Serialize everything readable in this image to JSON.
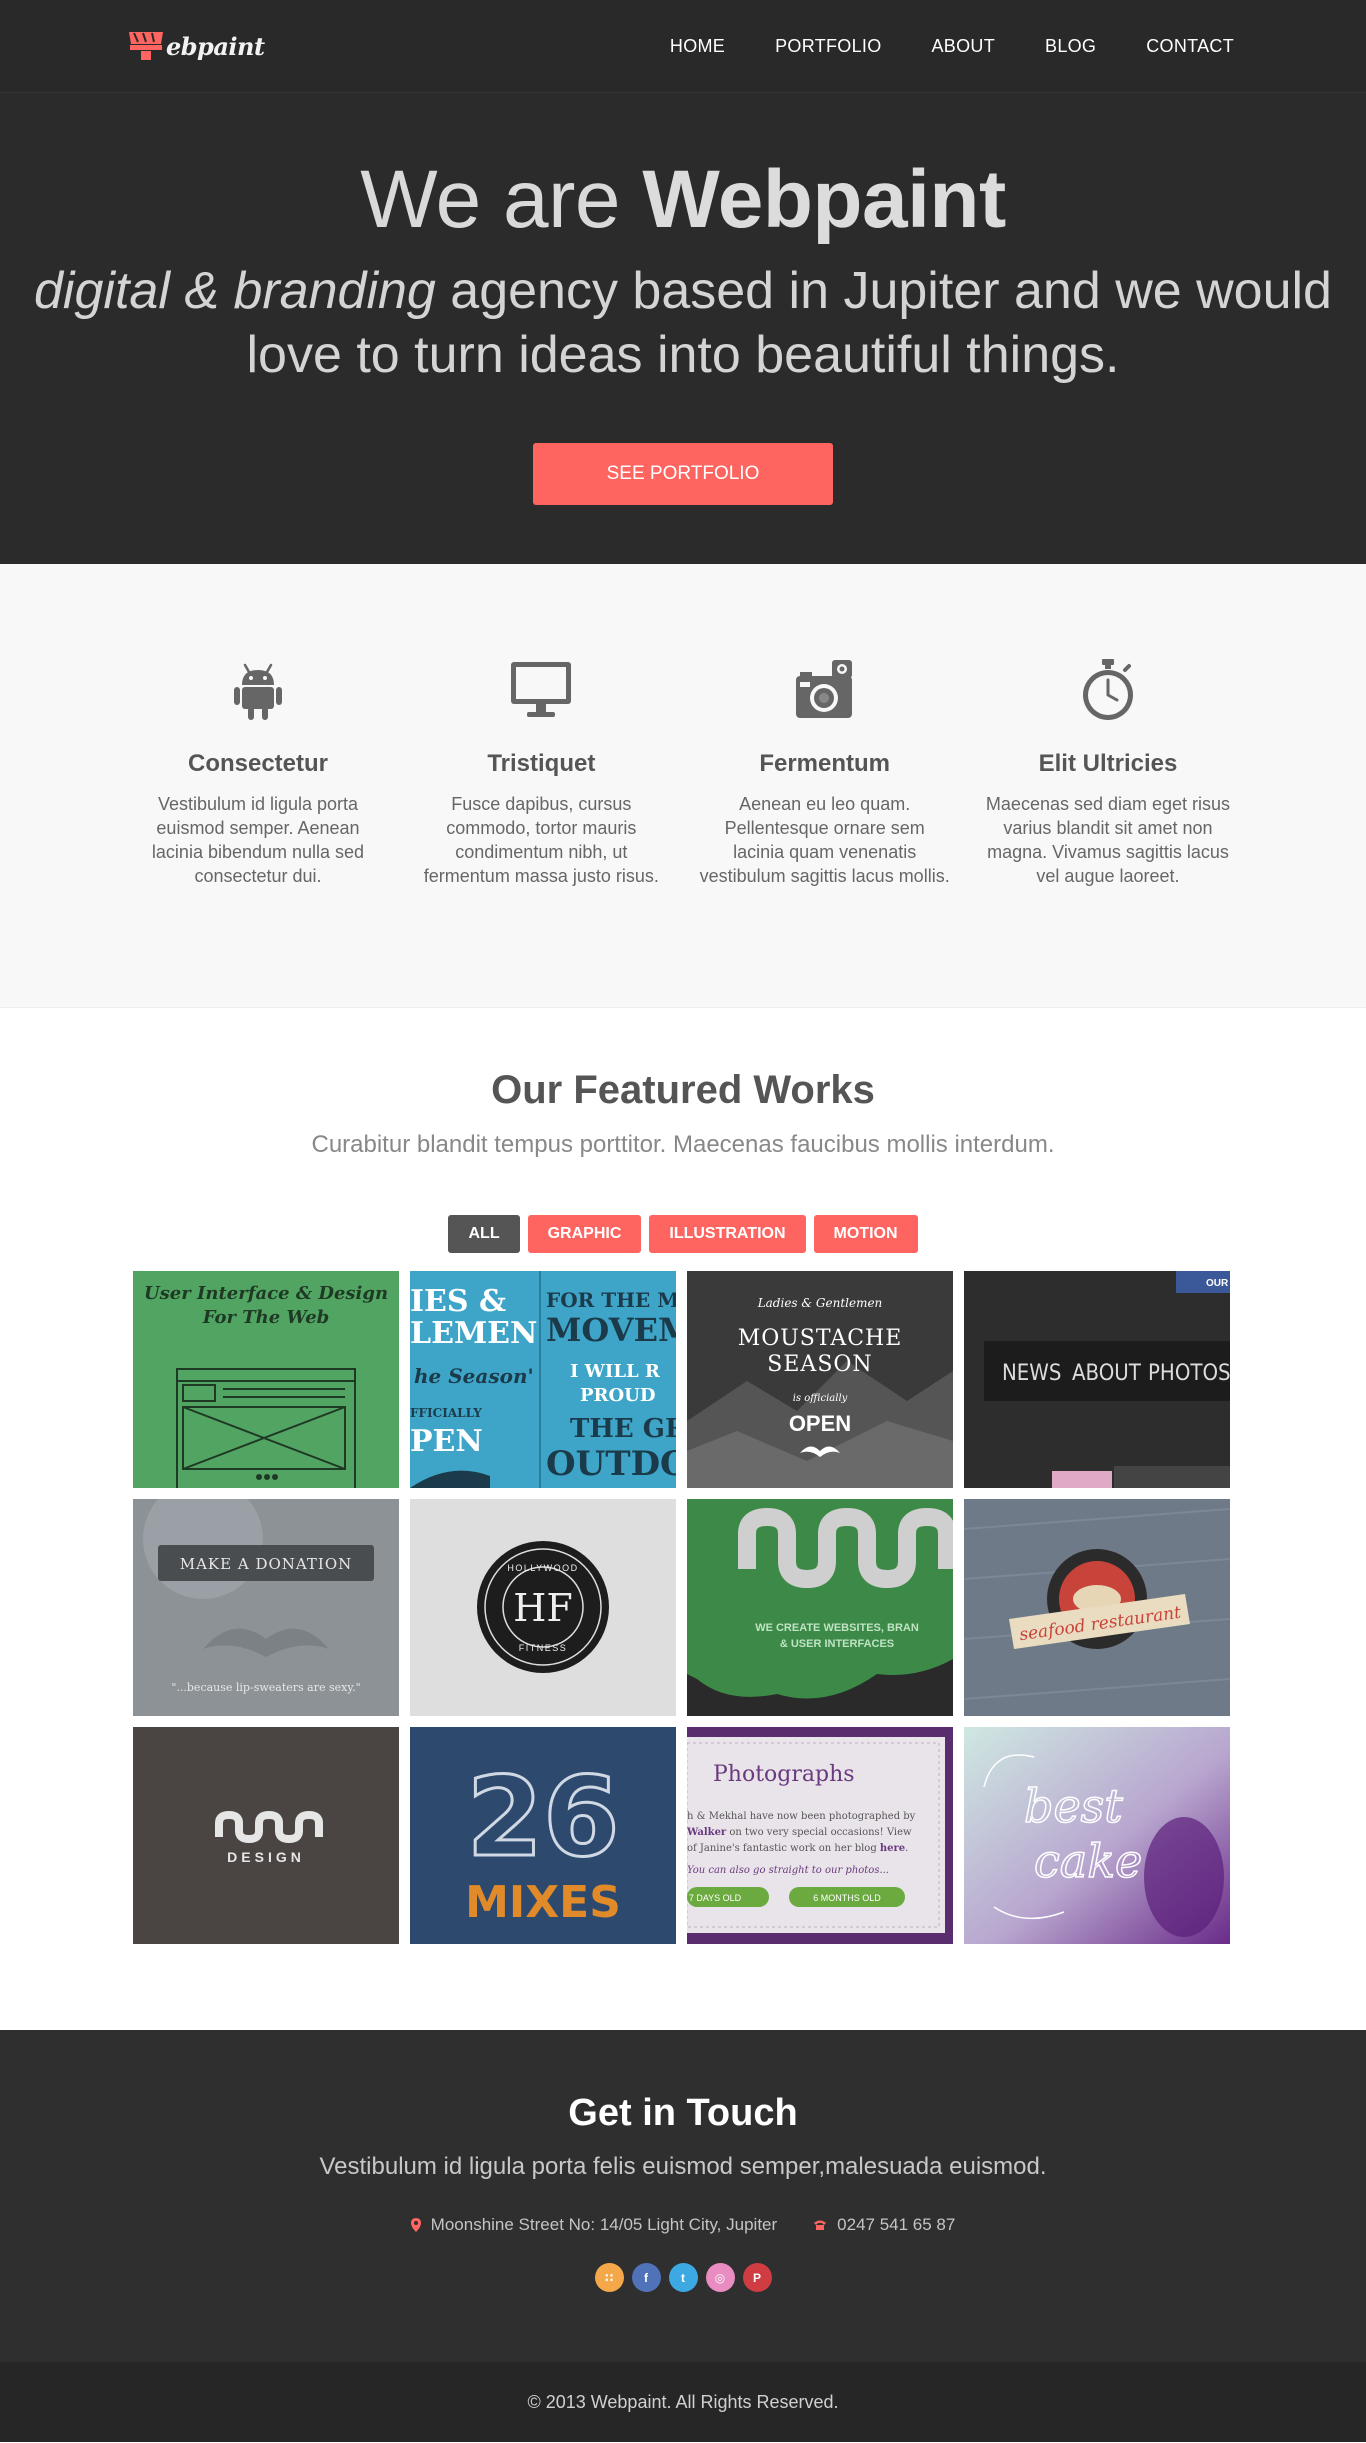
{
  "nav": {
    "logo_text": "ebpaint",
    "items": [
      {
        "label": "HOME"
      },
      {
        "label": "PORTFOLIO"
      },
      {
        "label": "ABOUT"
      },
      {
        "label": "BLOG"
      },
      {
        "label": "CONTACT"
      }
    ]
  },
  "hero": {
    "title_prefix": "We are ",
    "title_brand": "Webpaint",
    "tagline_italic": "digital & branding",
    "tagline_rest": " agency based in Jupiter and we would love to turn ideas into beautiful things.",
    "cta_label": "SEE PORTFOLIO"
  },
  "features": [
    {
      "icon": "android-icon",
      "title": "Consectetur",
      "text": "Vestibulum id ligula porta euismod semper. Aenean lacinia bibendum nulla sed consectetur dui."
    },
    {
      "icon": "monitor-icon",
      "title": "Tristiquet",
      "text": "Fusce dapibus, cursus commodo, tortor mauris condimentum nibh, ut fermentum massa justo risus."
    },
    {
      "icon": "camera-icon",
      "title": "Fermentum",
      "text": "Aenean eu leo quam. Pellentesque ornare sem lacinia quam venenatis vestibulum sagittis lacus mollis."
    },
    {
      "icon": "stopwatch-icon",
      "title": "Elit Ultricies",
      "text": "Maecenas sed diam eget risus varius blandit sit amet non magna. Vivamus sagittis lacus vel augue laoreet."
    }
  ],
  "works": {
    "title": "Our Featured Works",
    "subtitle": "Curabitur blandit tempus porttitor. Maecenas faucibus mollis interdum.",
    "filters": [
      {
        "label": "ALL",
        "active": true
      },
      {
        "label": "GRAPHIC",
        "active": false
      },
      {
        "label": "ILLUSTRATION",
        "active": false
      },
      {
        "label": "MOTION",
        "active": false
      }
    ],
    "tiles": {
      "t1": {
        "line1": "User Interface & Design",
        "line2": "For The Web"
      },
      "t2": {
        "a": "IES &",
        "b": "LEMEN",
        "c": "he Season'",
        "d": "FFICIALLY",
        "e": "PEN",
        "f": "FOR THE MO",
        "g": "MOVEM",
        "h": "I WILL R",
        "i": "PROUD",
        "j": "THE GR",
        "k": "OUTDO"
      },
      "t3": {
        "a": "Ladies & Gentlemen",
        "b": "MOUSTACHE",
        "c": "SEASON",
        "d": "is officially",
        "e": "OPEN"
      },
      "t4": {
        "badge": "OUR",
        "a": "NEWS",
        "b": "ABOUT",
        "c": "PHOTOS"
      },
      "t5": {
        "button": "MAKE A DONATION",
        "quote": "\"...because lip-sweaters are sexy.\""
      },
      "t6": {
        "top": "HOLLYWOOD",
        "mono": "HF",
        "bottom": "FITNESS"
      },
      "t7": {
        "a": "WE CREATE WEBSITES, BRAN",
        "b": "& USER INTERFACES"
      },
      "t8": {
        "banner": "seafood restaurant"
      },
      "t9": {
        "word": "DESIGN"
      },
      "t10": {
        "num": "26",
        "word": "MIXES"
      },
      "t11": {
        "title": "Photographs",
        "l1": "h & Mekhal have now been photographed by",
        "l2a": "Walker",
        "l2b": " on two very special occasions! View",
        "l3a": "of Janine's fantastic work on her blog ",
        "l3b": "here",
        "l3c": ".",
        "l4": "You can also go straight to our photos...",
        "b1": "7 DAYS OLD",
        "b2": "6 MONTHS OLD"
      },
      "t12": {
        "l1": "best",
        "l2": "cake"
      }
    }
  },
  "contact": {
    "title": "Get in Touch",
    "subtitle": "Vestibulum id ligula porta felis euismod semper,malesuada euismod.",
    "address": "Moonshine Street No: 14/05 Light City, Jupiter",
    "phone": "0247 541 65 87",
    "socials": [
      {
        "name": "rss-icon",
        "glyph": "∷",
        "color": "#f5a84a"
      },
      {
        "name": "facebook-icon",
        "glyph": "f",
        "color": "#4f72b8"
      },
      {
        "name": "twitter-icon",
        "glyph": "t",
        "color": "#3ca9e2"
      },
      {
        "name": "dribbble-icon",
        "glyph": "◎",
        "color": "#e88cc1"
      },
      {
        "name": "pinterest-icon",
        "glyph": "P",
        "color": "#cf3d42"
      }
    ]
  },
  "footer": {
    "copyright": "© 2013 Webpaint. All Rights Reserved."
  }
}
